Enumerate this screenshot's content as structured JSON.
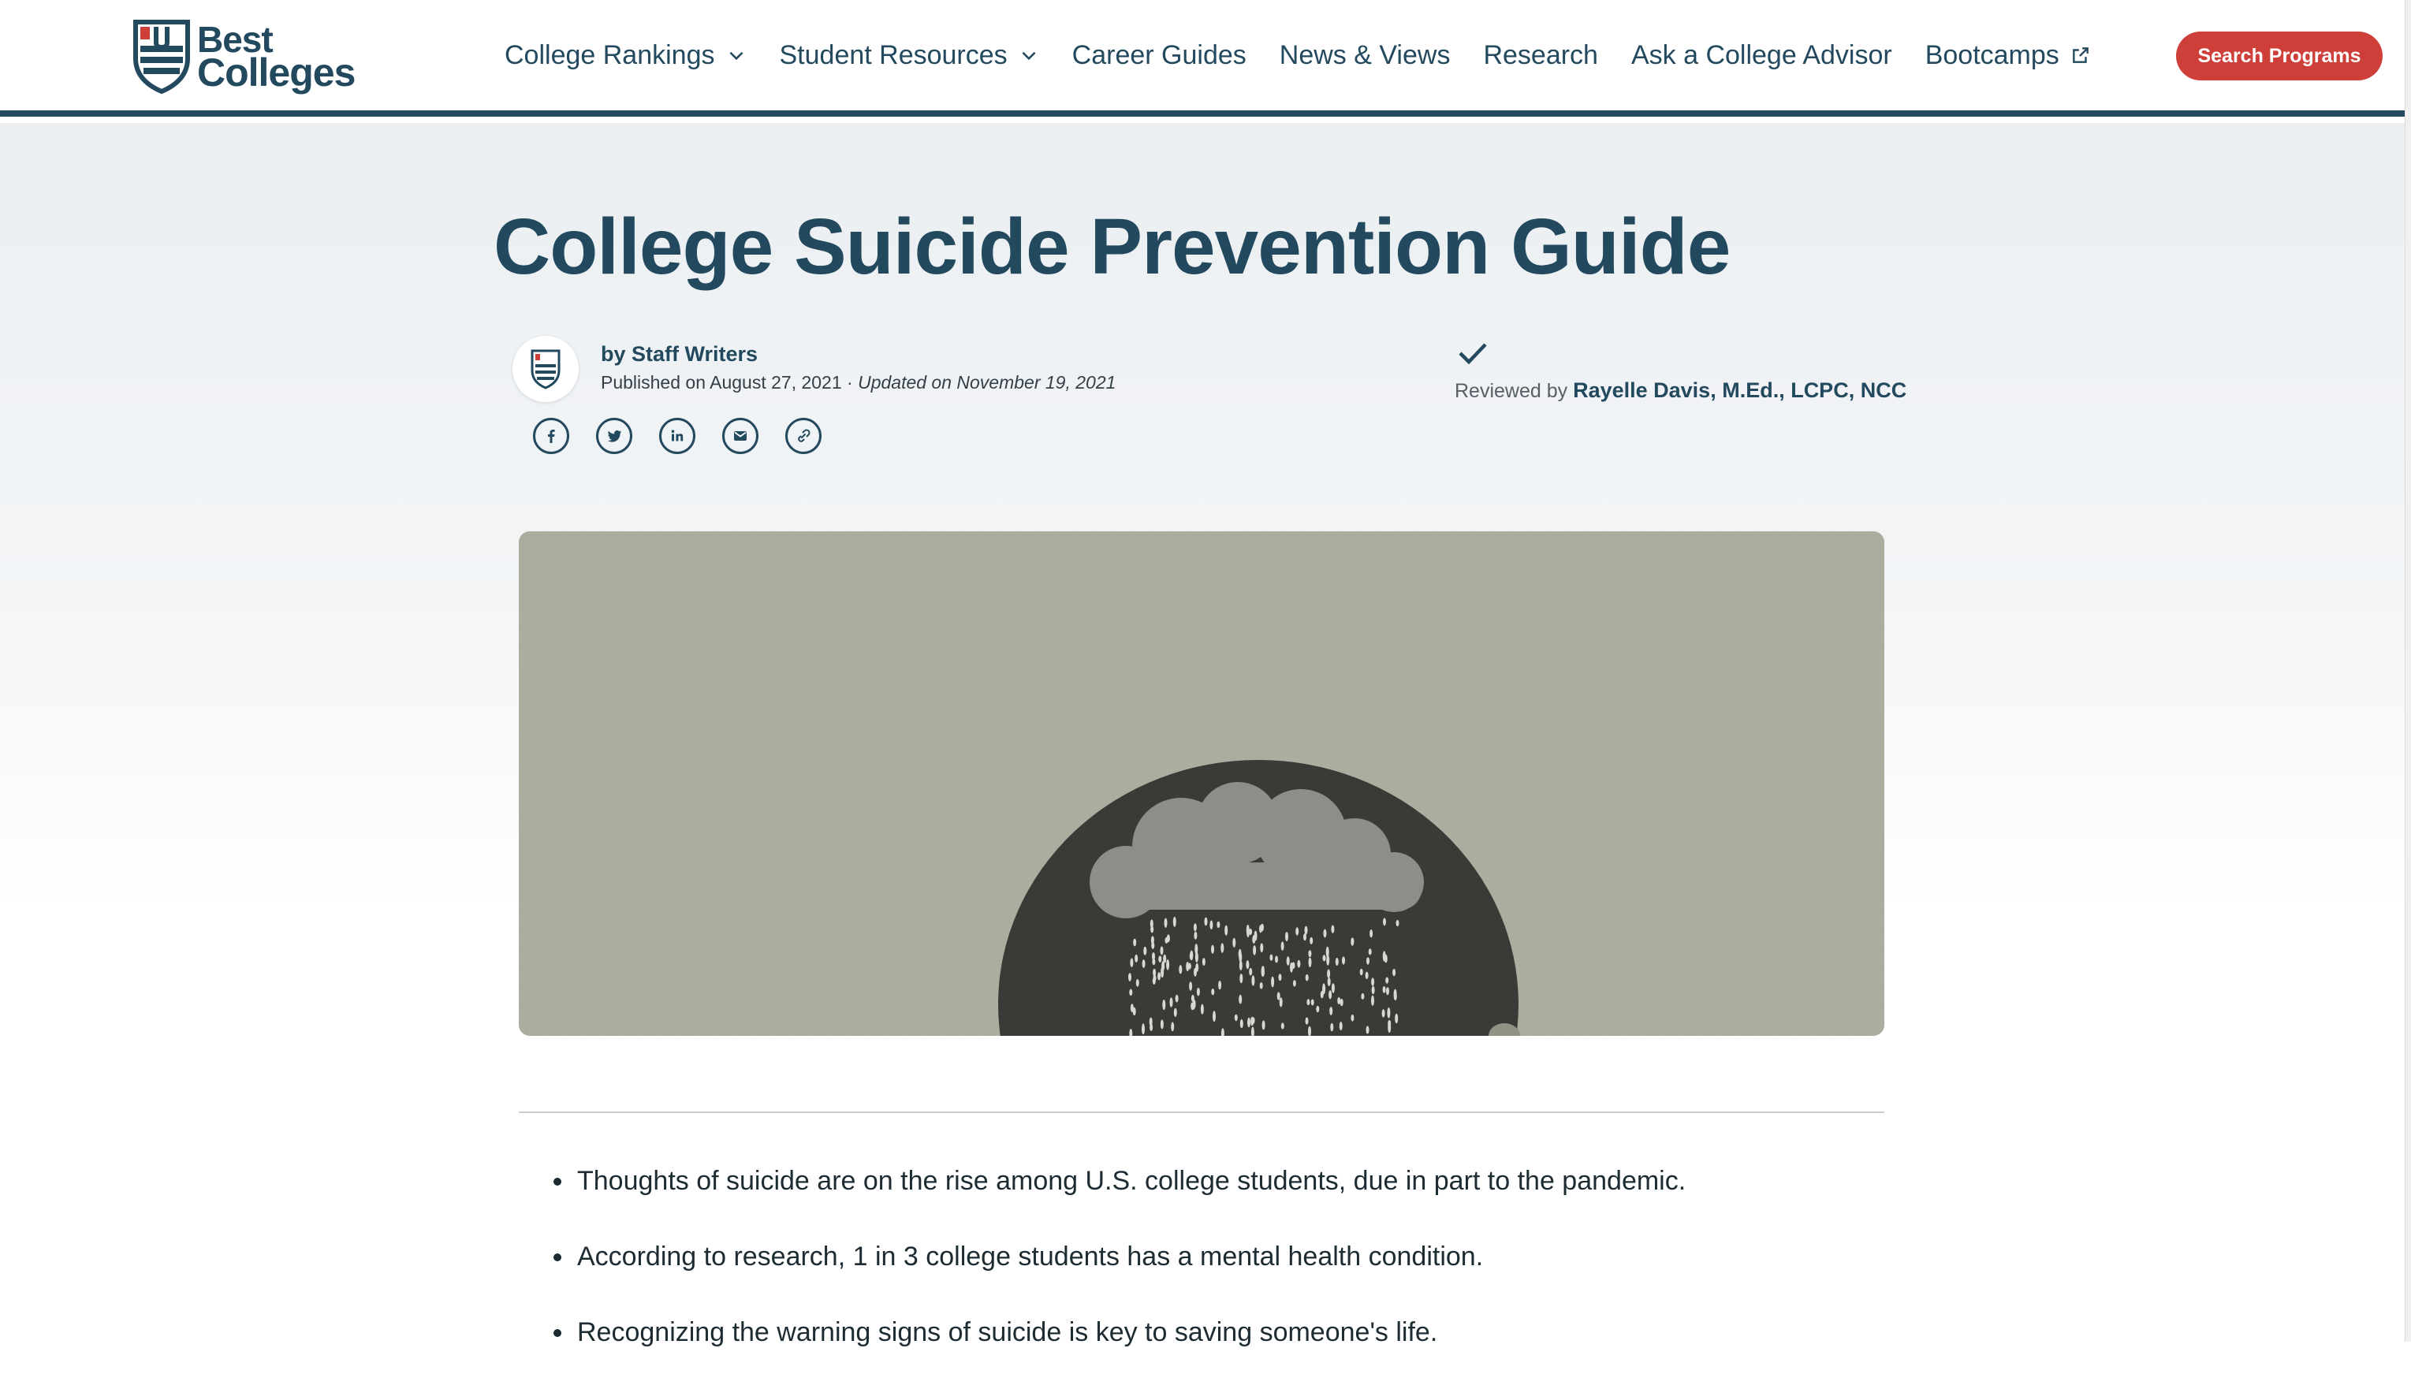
{
  "header": {
    "logo": {
      "line1": "Best",
      "line2": "Colleges"
    },
    "nav": [
      {
        "label": "College Rankings",
        "dropdown": true,
        "external": false
      },
      {
        "label": "Student Resources",
        "dropdown": true,
        "external": false
      },
      {
        "label": "Career Guides",
        "dropdown": false,
        "external": false
      },
      {
        "label": "News & Views",
        "dropdown": false,
        "external": false
      },
      {
        "label": "Research",
        "dropdown": false,
        "external": false
      },
      {
        "label": "Ask a College Advisor",
        "dropdown": false,
        "external": false
      },
      {
        "label": "Bootcamps",
        "dropdown": false,
        "external": true
      }
    ],
    "search_button": "Search Programs"
  },
  "article": {
    "title": "College Suicide Prevention Guide",
    "byline": "by Staff Writers",
    "published": "Published on August 27, 2021 · ",
    "updated": "Updated on November 19, 2021",
    "reviewed_prefix": "Reviewed by ",
    "reviewer": "Rayelle Davis, M.Ed., LCPC, NCC",
    "share_icons": [
      "facebook-icon",
      "twitter-icon",
      "linkedin-icon",
      "email-icon",
      "link-icon"
    ],
    "hero_image": "illustration: dark head silhouette with rain cloud",
    "takeaways": [
      "Thoughts of suicide are on the rise among U.S. college students, due in part to the pandemic.",
      "According to research, 1 in 3 college students has a mental health condition.",
      "Recognizing the warning signs of suicide is key to saving someone's life."
    ]
  },
  "colors": {
    "brand_navy": "#23495e",
    "cta_red": "#cf3f3a",
    "hero_bg": "#a8ad9f"
  }
}
